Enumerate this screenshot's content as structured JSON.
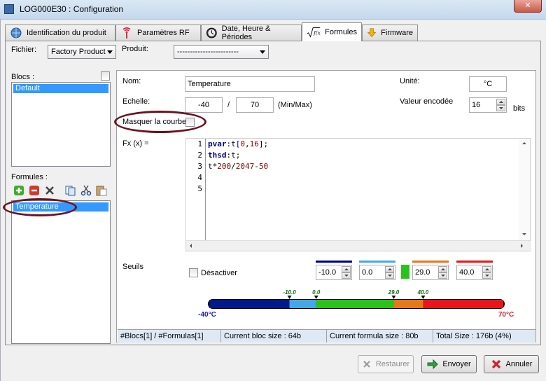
{
  "window": {
    "title": "LOG000E30 : Configuration",
    "close": "✕"
  },
  "tabs": [
    {
      "label": "Identification du produit",
      "icon": "globe-icon"
    },
    {
      "label": "Paramètres RF",
      "icon": "antenna-icon"
    },
    {
      "label": "Date, Heure & Périodes",
      "icon": "clock-icon"
    },
    {
      "label": "Formules",
      "icon": "sqrt-formula-icon",
      "active": true
    },
    {
      "label": "Firmware",
      "icon": "download-arrow-icon"
    }
  ],
  "top": {
    "fichier_label": "Fichier:",
    "fichier_value": "Factory Product",
    "produit_label": "Produit:",
    "produit_value": "------------------------"
  },
  "left": {
    "blocs_label": "Blocs :",
    "blocs_items": [
      "Default"
    ],
    "formules_label": "Formules :",
    "formules_items": [
      "Temperature"
    ]
  },
  "form": {
    "nom_label": "Nom:",
    "nom_value": "Temperature",
    "unite_label": "Unité:",
    "unite_value": "°C",
    "echelle_label": "Echelle:",
    "echelle_min": "-40",
    "echelle_sep": "/",
    "echelle_max": "70",
    "echelle_hint": "(Min/Max)",
    "valeur_label": "Valeur encodée",
    "valeur_value": "16",
    "valeur_unit": "bits",
    "masquer_label": "Masquer la courbe",
    "fx_label": "Fx (x) ="
  },
  "code": {
    "line_numbers": [
      "1",
      "2",
      "3",
      "4",
      "5"
    ],
    "lines": [
      "pvar:t[0,16];",
      "thsd:t;",
      "t*200/2047-50",
      "",
      ""
    ]
  },
  "seuils": {
    "label": "Seuils",
    "desactiver_label": "Désactiver",
    "values": [
      "-10.0",
      "0.0",
      "29.0",
      "40.0"
    ],
    "colors": [
      "#00007f",
      "#45a8e6",
      "#e67817",
      "#e8161a"
    ],
    "middle_color": "#2cc21c",
    "bar_min": -40,
    "bar_max": 70,
    "min_label": "-40°C",
    "max_label": "70°C",
    "marker_labels": [
      "-10.0",
      "0.0",
      "29.0",
      "40.0"
    ],
    "segment_colors": [
      "#001a8a",
      "#45a8e6",
      "#2cc21c",
      "#e67817",
      "#e8161a"
    ]
  },
  "status": {
    "blocs": "#Blocs[1] / #Formulas[1]",
    "bloc_size": "Current bloc size : 64b",
    "formula_size": "Current formula size : 80b",
    "total": "Total Size : 176b (4%)"
  },
  "buttons": {
    "restaurer": "Restaurer",
    "envoyer": "Envoyer",
    "annuler": "Annuler"
  }
}
